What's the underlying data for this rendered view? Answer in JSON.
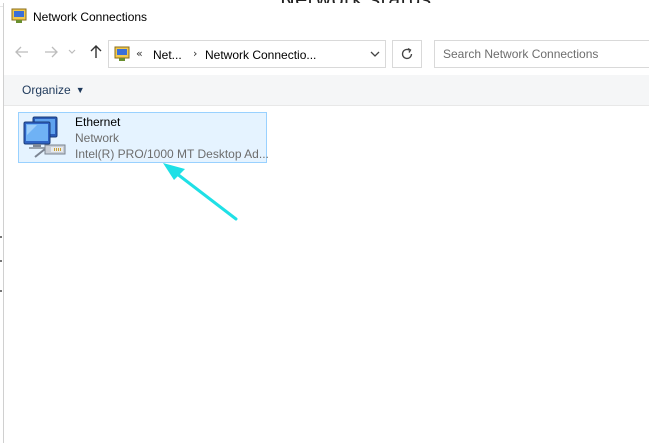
{
  "window": {
    "title": "Network Connections",
    "background_heading": "Network status"
  },
  "navbar": {
    "back_icon": "arrow-left-icon",
    "forward_icon": "arrow-right-icon",
    "recent_icon": "chevron-down-icon",
    "up_icon": "arrow-up-icon",
    "address": {
      "overflow": "«",
      "segments": [
        "Net...",
        "Network Connectio..."
      ]
    },
    "refresh_icon": "refresh-icon",
    "search": {
      "placeholder": "Search Network Connections",
      "value": ""
    }
  },
  "commandbar": {
    "organize_label": "Organize"
  },
  "connections": [
    {
      "name": "Ethernet",
      "status": "Network",
      "device": "Intel(R) PRO/1000 MT Desktop Ad..."
    }
  ],
  "annotation": {
    "arrow_color": "#1fe0e6"
  },
  "colors": {
    "selection_fill": "#e5f3ff",
    "selection_border": "#99d1ff",
    "command_bar": "#f5f6f7"
  }
}
